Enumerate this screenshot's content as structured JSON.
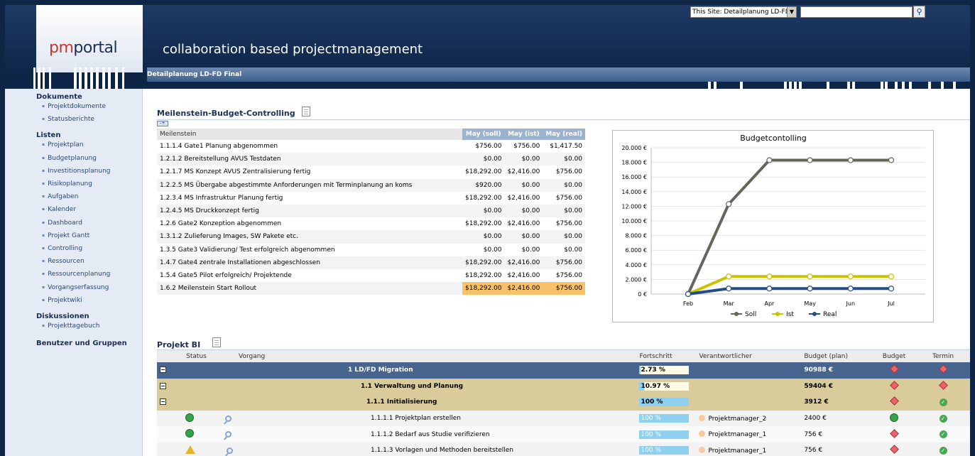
{
  "header": {
    "logo_pm": "pm",
    "logo_portal": "portal",
    "tagline": "collaboration based projectmanagement",
    "scope_value": "This Site: Detailplanung LD-FD",
    "breadcrumb": "Detailplanung LD-FD Final"
  },
  "sidebar": {
    "sections": [
      {
        "title": "Dokumente",
        "items": [
          "Projektdokumente",
          "Statusberichte"
        ]
      },
      {
        "title": "Listen",
        "items": [
          "Projektplan",
          "Budgetplanung",
          "Investitionsplanung",
          "Risikoplanung",
          "Aufgaben",
          "Kalender",
          "Dashboard",
          "Projekt Gantt",
          "Controlling",
          "Ressourcen",
          "Ressourcenplanung",
          "Vorgangserfassung",
          "Projektwiki"
        ]
      },
      {
        "title": "Diskussionen",
        "items": [
          "Projekttagebuch"
        ]
      },
      {
        "title": "Benutzer und Gruppen",
        "items": []
      }
    ]
  },
  "milestones": {
    "title": "Meilenstein-Budget-Controlling",
    "headers": [
      "Meilenstein",
      "May (soll)",
      "May (ist)",
      "May (real)"
    ],
    "rows": [
      [
        "1.1.1.4 Gate1 Planung abgenommen",
        "$756.00",
        "$756.00",
        "$1,417.50"
      ],
      [
        "1.2.1.2 Bereitstellung AVUS Testdaten",
        "$0.00",
        "$0.00",
        "$0.00"
      ],
      [
        "1.2.1.7 MS Konzept AVUS Zentralisierung fertig",
        "$18,292.00",
        "$2,416.00",
        "$756.00"
      ],
      [
        "1.2.2.5 MS Übergabe abgestimmte Anforderungen mit Terminplanung an koms",
        "$920.00",
        "$0.00",
        "$0.00"
      ],
      [
        "1.2.3.4 MS Infrastruktur Planung fertig",
        "$18,292.00",
        "$2,416.00",
        "$756.00"
      ],
      [
        "1.2.4.5 MS Druckkonzept fertig",
        "$0.00",
        "$0.00",
        "$0.00"
      ],
      [
        "1.2.6 Gate2 Konzeption abgenommen",
        "$18,292.00",
        "$2,416.00",
        "$756.00"
      ],
      [
        "1.3.1.2 Zulieferung Images, SW Pakete etc.",
        "$0.00",
        "$0.00",
        "$0.00"
      ],
      [
        "1.3.5 Gate3 Validierung/ Test erfolgreich abgenommen",
        "$0.00",
        "$0.00",
        "$0.00"
      ],
      [
        "1.4.7 Gate4 zentrale Installationen abgeschlossen",
        "$18,292.00",
        "$2,416.00",
        "$756.00"
      ],
      [
        "1.5.4 Gate5 Pilot erfolgreich/ Projektende",
        "$18,292.00",
        "$2,416.00",
        "$756.00"
      ],
      [
        "1.6.2 Meilenstein Start Rollout",
        "$18,292.00",
        "$2,416.00",
        "$756.00"
      ]
    ]
  },
  "chart_data": {
    "type": "line",
    "title": "Budgetcontolling",
    "categories": [
      "Feb",
      "Mar",
      "Apr",
      "May",
      "Jun",
      "Jul"
    ],
    "y_ticks": [
      "0 €",
      "2.000 €",
      "4.000 €",
      "6.000 €",
      "8.000 €",
      "10.000 €",
      "12.000 €",
      "14.000 €",
      "16.000 €",
      "18.000 €",
      "20.000 €"
    ],
    "ylim": [
      0,
      20000
    ],
    "series": [
      {
        "name": "Soll",
        "color": "#66655c",
        "values": [
          0,
          12300,
          18300,
          18300,
          18300,
          18300
        ]
      },
      {
        "name": "Ist",
        "color": "#c9c400",
        "values": [
          0,
          2400,
          2400,
          2400,
          2400,
          2400
        ]
      },
      {
        "name": "Real",
        "color": "#254c86",
        "values": [
          0,
          750,
          750,
          750,
          750,
          750
        ]
      }
    ],
    "legend": "bottom"
  },
  "project": {
    "title": "Projekt BI",
    "headers": [
      "Status",
      "Vorgang",
      "Fortschritt",
      "Verantwortlicher",
      "Budget (plan)",
      "Budget",
      "Termin"
    ],
    "rows": [
      {
        "level": 0,
        "vorgang": "1 LD/FD Migration",
        "progress": "2.73 %",
        "pct": 2.73,
        "resp": "",
        "budget_plan": "90988 €",
        "budget": "diamond",
        "termin": "diamond"
      },
      {
        "level": 1,
        "vorgang": "1.1 Verwaltung und Planung",
        "progress": "10.97 %",
        "pct": 10.97,
        "resp": "",
        "budget_plan": "59404 €",
        "budget": "diamond",
        "termin": "diamond"
      },
      {
        "level": 2,
        "vorgang": "1.1.1 Initialisierung",
        "progress": "100 %",
        "pct": 100,
        "resp": "",
        "budget_plan": "3912 €",
        "budget": "diamond",
        "termin": "check"
      },
      {
        "level": 3,
        "status": "green",
        "vorgang": "1.1.1.1 Projektplan erstellen",
        "progress": "100 %",
        "pct": 100,
        "resp": "Projektmanager_2",
        "budget_plan": "2400 €",
        "budget": "green",
        "termin": "check"
      },
      {
        "level": 3,
        "status": "green",
        "vorgang": "1.1.1.2 Bedarf aus Studie verifizieren",
        "progress": "100 %",
        "pct": 100,
        "resp": "Projektmanager_1",
        "budget_plan": "756 €",
        "budget": "diamond",
        "termin": "check"
      },
      {
        "level": 3,
        "status": "warn",
        "vorgang": "1.1.1.3 Vorlagen und Methoden bereitstellen",
        "progress": "100 %",
        "pct": 100,
        "resp": "Projektmanager_1",
        "budget_plan": "756 €",
        "budget": "diamond",
        "termin": "check"
      }
    ]
  }
}
